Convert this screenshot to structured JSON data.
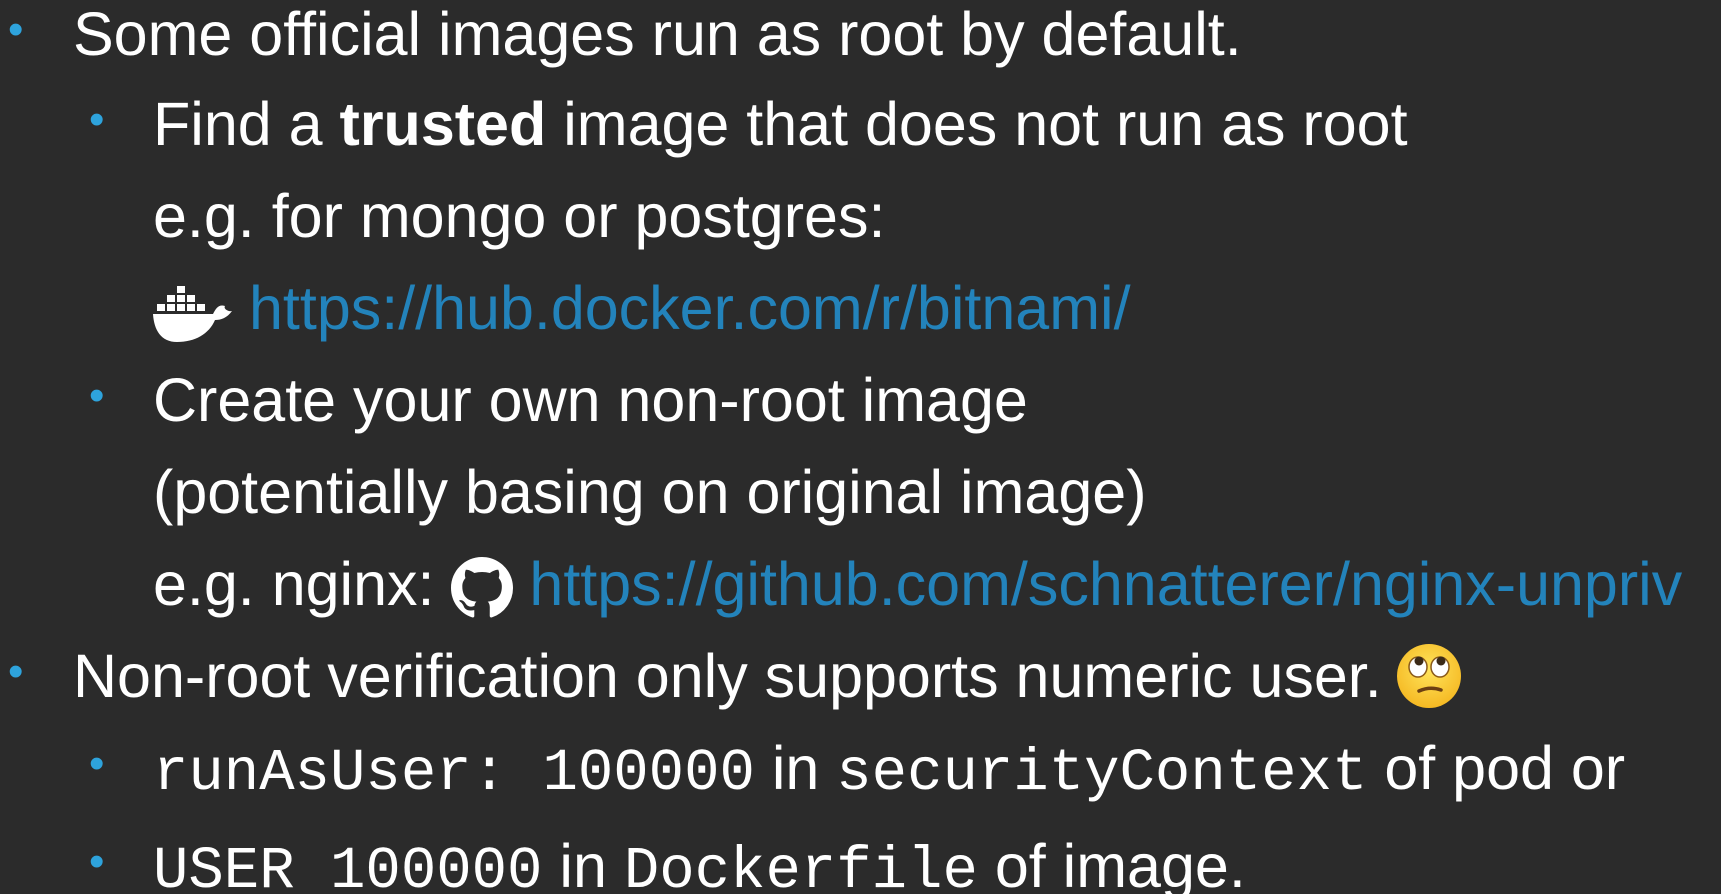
{
  "colors": {
    "background": "#2b2b2b",
    "text": "#ffffff",
    "bullet": "#2ea3dc",
    "link": "#2383bb"
  },
  "bullets": {
    "b1": {
      "text": "Some official images run as root by default."
    },
    "b1_1": {
      "prefix": "Find a ",
      "bold": "trusted",
      "suffix": " image that does not run as root"
    },
    "b1_1_cont": {
      "text": "e.g. for mongo or postgres:"
    },
    "b1_1_link": {
      "icon": "docker-icon",
      "url": "https://hub.docker.com/r/bitnami/"
    },
    "b1_2": {
      "text": "Create your own non-root image"
    },
    "b1_2_cont": {
      "text": "(potentially basing on original image)"
    },
    "b1_2_link": {
      "prefix": "e.g. nginx: ",
      "icon": "github-icon",
      "url": "https://github.com/schnatterer/nginx-unpriv"
    },
    "b2": {
      "text": "Non-root verification only supports numeric user.",
      "icon": "eye-roll-emoji-icon"
    },
    "b2_1": {
      "code1": "runAsUser: 100000",
      "mid": " in ",
      "code2": "securityContext",
      "suffix": " of pod or"
    },
    "b2_2": {
      "code1": "USER 100000",
      "mid": " in ",
      "code2": "Dockerfile",
      "suffix": " of image."
    }
  }
}
